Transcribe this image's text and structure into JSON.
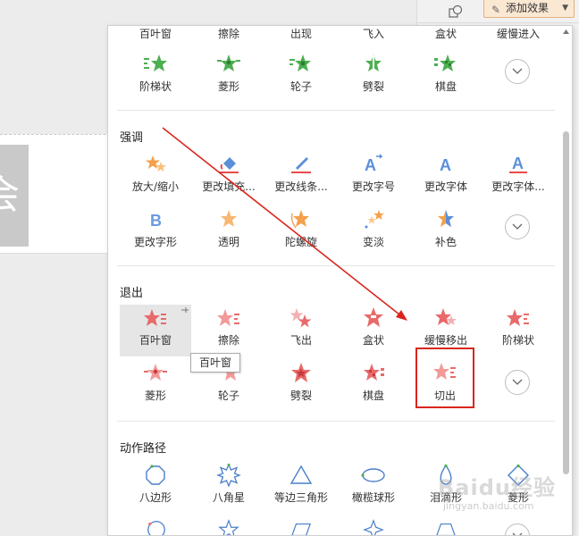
{
  "header": {
    "add_effect_label": "添加效果"
  },
  "entrance_tail": {
    "labels_top": [
      "百叶窗",
      "擦除",
      "出现",
      "飞入",
      "盒状",
      "缓慢进入"
    ],
    "row2": [
      "阶梯状",
      "菱形",
      "轮子",
      "劈裂",
      "棋盘"
    ]
  },
  "emphasis": {
    "title": "强调",
    "row1": [
      "放大/缩小",
      "更改填充...",
      "更改线条...",
      "更改字号",
      "更改字体",
      "更改字体..."
    ],
    "row2": [
      "更改字形",
      "透明",
      "陀螺旋",
      "变淡",
      "补色"
    ]
  },
  "exit": {
    "title": "退出",
    "row1": [
      "百叶窗",
      "擦除",
      "飞出",
      "盒状",
      "缓慢移出",
      "阶梯状"
    ],
    "row2": [
      "菱形",
      "轮子",
      "劈裂",
      "棋盘",
      "切出"
    ]
  },
  "motion_path": {
    "title": "动作路径",
    "row1": [
      "八边形",
      "八角星",
      "等边三角形",
      "橄榄球形",
      "泪滴形",
      "菱形"
    ]
  },
  "tooltip": "百叶窗",
  "watermark": {
    "main": "Baidu经验",
    "sub": "jingyan.baidu.com"
  },
  "colors": {
    "entrance_green": "#4caf50",
    "emphasis_orange": "#f5a04a",
    "emphasis_blue": "#5b8fd9",
    "exit_red": "#e86a6a",
    "path_blue": "#4a7fc8",
    "highlight_red": "#d9261c"
  }
}
